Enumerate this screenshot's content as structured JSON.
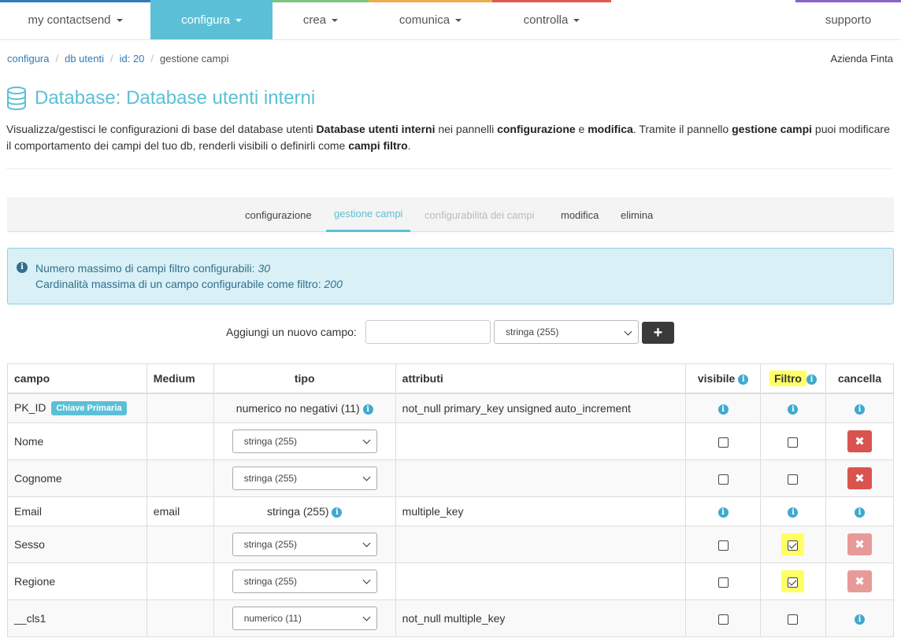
{
  "nav": {
    "items": [
      {
        "label": "my contactsend",
        "color": "#337ab7"
      },
      {
        "label": "configura",
        "color": "#5bc0d6"
      },
      {
        "label": "crea",
        "color": "#7bc67b"
      },
      {
        "label": "comunica",
        "color": "#f0ad4e"
      },
      {
        "label": "controlla",
        "color": "#e05a4f"
      },
      {
        "label": "supporto",
        "color": "#8a63c9"
      }
    ]
  },
  "breadcrumb": [
    "configura",
    "db utenti",
    "id: 20",
    "gestione campi"
  ],
  "company": "Azienda Finta",
  "title": "Database: Database utenti interni",
  "description": {
    "p1": "Visualizza/gestisci le configurazioni di base del database utenti ",
    "b1": "Database utenti interni",
    "p2": " nei pannelli ",
    "b2": "configurazione",
    "p3": " e ",
    "b3": "modifica",
    "p4": ". Tramite il pannello ",
    "b4": "gestione campi",
    "p5": " puoi modificare il comportamento dei campi del tuo db, renderli visibili o definirli come ",
    "b5": "campi filtro",
    "p6": "."
  },
  "subtabs": [
    {
      "label": "configurazione",
      "state": "normal"
    },
    {
      "label": "gestione campi",
      "state": "active"
    },
    {
      "label": "configurabilità dei campi",
      "state": "disabled"
    },
    {
      "label": "modifica",
      "state": "normal"
    },
    {
      "label": "elimina",
      "state": "normal"
    }
  ],
  "info": {
    "line1_text": "Numero massimo di campi filtro configurabili: ",
    "line1_value": "30",
    "line2_text": "Cardinalità massima di un campo configurabile come filtro: ",
    "line2_value": "200"
  },
  "add_field": {
    "label": "Aggiungi un nuovo campo:",
    "value": "",
    "type_selected": "stringa (255)",
    "add_symbol": "+"
  },
  "table": {
    "headers": {
      "campo": "campo",
      "medium": "Medium",
      "tipo": "tipo",
      "attributi": "attributi",
      "visibile": "visibile",
      "filtro": "Filtro",
      "cancella": "cancella"
    },
    "primary_badge": "Chiave Primaria",
    "rows": [
      {
        "campo": "PK_ID",
        "medium": "",
        "tipo": "numerico no negativi (11)",
        "tipo_editable": false,
        "attributi": "not_null primary_key unsigned auto_increment",
        "visibile": "info",
        "filtro": "info",
        "cancella": "info"
      },
      {
        "campo": "Nome",
        "medium": "",
        "tipo": "stringa (255)",
        "tipo_editable": true,
        "attributi": "",
        "visibile": "unchecked",
        "filtro": "unchecked",
        "cancella": "button"
      },
      {
        "campo": "Cognome",
        "medium": "",
        "tipo": "stringa (255)",
        "tipo_editable": true,
        "attributi": "",
        "visibile": "unchecked",
        "filtro": "unchecked",
        "cancella": "button"
      },
      {
        "campo": "Email",
        "medium": "email",
        "tipo": "stringa (255)",
        "tipo_editable": false,
        "attributi": "multiple_key",
        "visibile": "info",
        "filtro": "info",
        "cancella": "info"
      },
      {
        "campo": "Sesso",
        "medium": "",
        "tipo": "stringa (255)",
        "tipo_editable": true,
        "attributi": "",
        "visibile": "unchecked",
        "filtro": "checked",
        "cancella": "button-disabled"
      },
      {
        "campo": "Regione",
        "medium": "",
        "tipo": "stringa (255)",
        "tipo_editable": true,
        "attributi": "",
        "visibile": "unchecked",
        "filtro": "checked",
        "cancella": "button-disabled"
      },
      {
        "campo": "__cls1",
        "medium": "",
        "tipo": "numerico (11)",
        "tipo_editable": true,
        "attributi": "not_null multiple_key",
        "visibile": "unchecked",
        "filtro": "unchecked",
        "cancella": "info"
      }
    ]
  }
}
